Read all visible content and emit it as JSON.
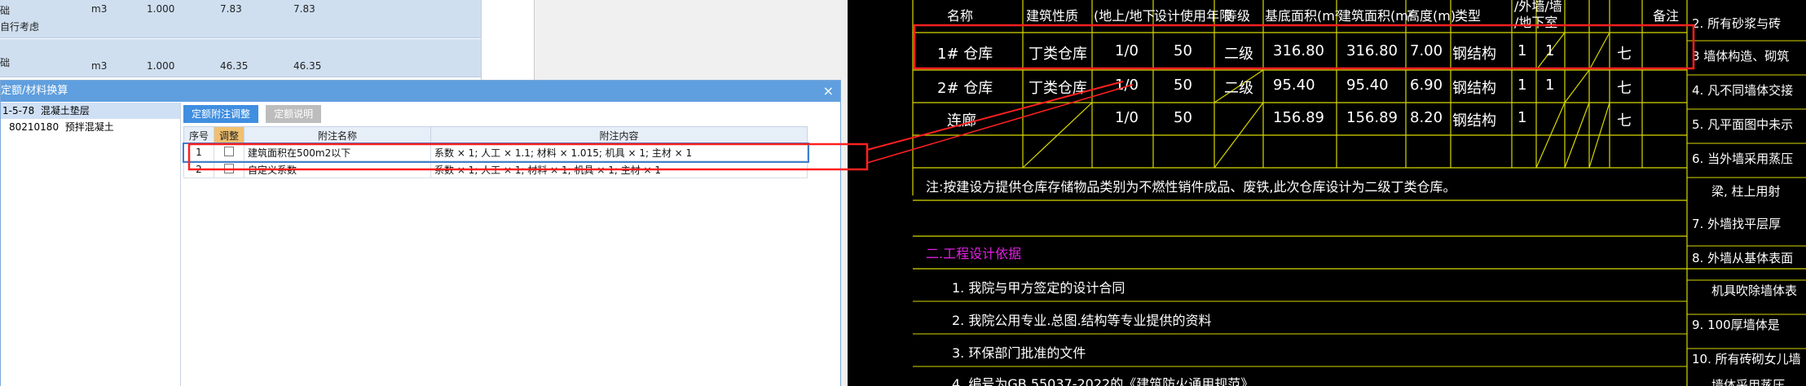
{
  "background_table": {
    "rows": [
      {
        "name_a": "础",
        "name_b": "自行考虑",
        "unit": "m3",
        "qty": "1.000",
        "price": "7.83",
        "total": "7.83"
      },
      {
        "name_a": "础",
        "name_b": "",
        "unit": "m3",
        "qty": "1.000",
        "price": "46.35",
        "total": "46.35"
      }
    ]
  },
  "dialog": {
    "title": "定额/材料换算",
    "close": "×",
    "tree": [
      {
        "code": "1-5-78",
        "name": "混凝土垫层"
      },
      {
        "code": "80210180",
        "name": "预拌混凝土"
      }
    ],
    "tabs": [
      "定额附注调整",
      "定额说明"
    ],
    "grid": {
      "headers": [
        "序号",
        "调整",
        "附注名称",
        "附注内容"
      ],
      "rows": [
        {
          "no": "1",
          "name": "建筑面积在500m2以下",
          "content": "系数 × 1; 人工 × 1.1; 材料 × 1.015; 机具 × 1; 主材 × 1"
        },
        {
          "no": "2",
          "name": "自定义系数",
          "content": "系数 × 1; 人工 × 1; 材料 × 1; 机具 × 1; 主材 × 1"
        }
      ]
    }
  },
  "cad": {
    "headers": [
      "名称",
      "建筑性质",
      "(地上/地下",
      "设计使用年限",
      "等级",
      "基底面积(m²",
      "建筑面积(m²",
      "高度(m)",
      "类型",
      "/外墙/墙",
      "/地下室",
      "备注"
    ],
    "rows": [
      {
        "name": "1# 仓库",
        "nature": "丁类仓库",
        "floors": "1/0",
        "years": "50",
        "grade": "二级",
        "base": "316.80",
        "area": "316.80",
        "height": "7.00",
        "type": "钢结构",
        "a": "1",
        "b": "1",
        "c": "七"
      },
      {
        "name": "2# 仓库",
        "nature": "丁类仓库",
        "floors": "1/0",
        "years": "50",
        "grade": "二级",
        "base": "95.40",
        "area": "95.40",
        "height": "6.90",
        "type": "钢结构",
        "a": "1",
        "b": "1",
        "c": "七"
      },
      {
        "name": "连廊",
        "nature": "",
        "floors": "1/0",
        "years": "50",
        "grade": "",
        "base": "156.89",
        "area": "156.89",
        "height": "8.20",
        "type": "钢结构",
        "a": "1",
        "b": "",
        "c": "七"
      }
    ],
    "note": "注:按建设方提供仓库存储物品类别为不燃性销件成品、废铁,此次仓库设计为二级丁类仓库。",
    "section_title": "二.工程设计依据",
    "items": [
      "1. 我院与甲方签定的设计合同",
      "2. 我院公用专业.总图.结构等专业提供的资料",
      "3. 环保部门批准的文件",
      "4. 编号为GB 55037-2022的《建筑防火通用规范》"
    ],
    "side_notes": [
      "2. 所有砂浆与砖",
      "3 墙体构造、砌筑",
      "4. 凡不同墙体交接",
      "5. 凡平面图中未示",
      "6. 当外墙采用蒸压",
      "梁, 柱上用射",
      "7. 外墙找平层厚",
      "8. 外墙从基体表面",
      "机具吹除墙体表",
      "9. 100厚墙体是",
      "10. 所有砖砌女儿墙",
      "墙体采用蒸压"
    ]
  },
  "colors": {
    "highlight": "#ff2020",
    "cad_line": "#d8d800",
    "cad_text": "#ffffff",
    "section": "#e020e0"
  }
}
